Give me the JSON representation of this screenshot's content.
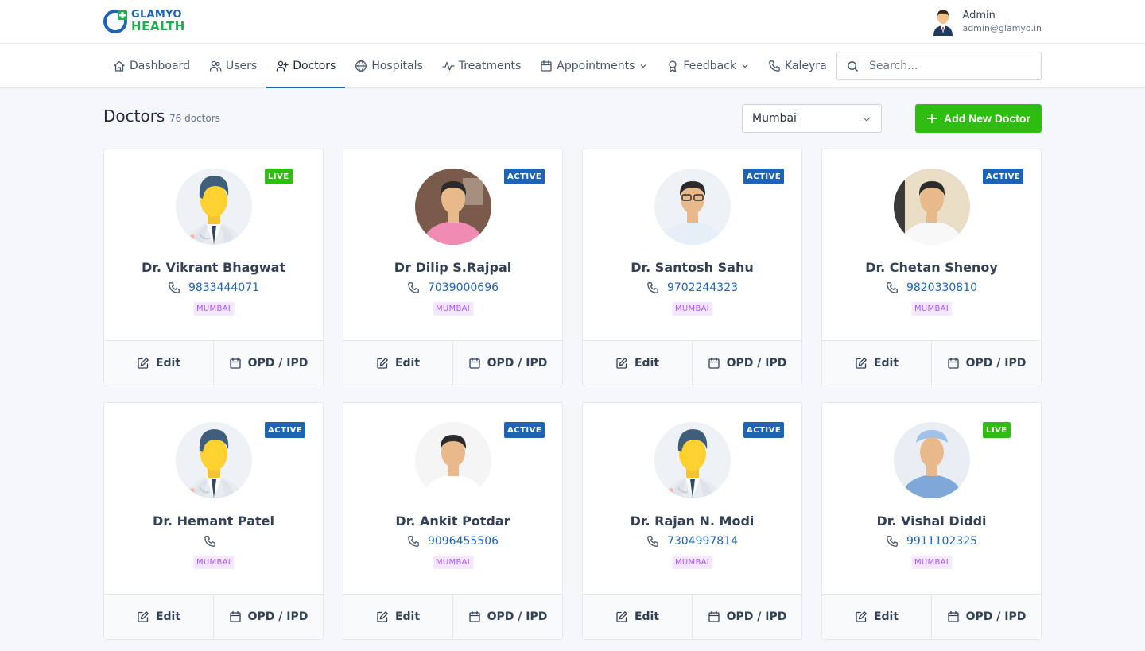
{
  "brand": {
    "line1": "GLAMYO",
    "line2": "HEALTH"
  },
  "user": {
    "name": "Admin",
    "email": "admin@glamyo.in"
  },
  "nav": [
    {
      "label": "Dashboard",
      "icon": "home-icon",
      "active": false,
      "dropdown": false
    },
    {
      "label": "Users",
      "icon": "users-icon",
      "active": false,
      "dropdown": false
    },
    {
      "label": "Doctors",
      "icon": "user-plus-icon",
      "active": true,
      "dropdown": false
    },
    {
      "label": "Hospitals",
      "icon": "globe-icon",
      "active": false,
      "dropdown": false
    },
    {
      "label": "Treatments",
      "icon": "activity-icon",
      "active": false,
      "dropdown": false
    },
    {
      "label": "Appointments",
      "icon": "calendar-icon",
      "active": false,
      "dropdown": true
    },
    {
      "label": "Feedback",
      "icon": "award-icon",
      "active": false,
      "dropdown": true
    },
    {
      "label": "Kaleyra",
      "icon": "phone-icon",
      "active": false,
      "dropdown": false
    }
  ],
  "search": {
    "placeholder": "Search..."
  },
  "page": {
    "title": "Doctors",
    "count": "76 doctors",
    "city_selected": "Mumbai",
    "add_button": "Add New Doctor"
  },
  "card_actions": {
    "edit": "Edit",
    "opd": "OPD / IPD"
  },
  "doctors": [
    {
      "name": "Dr. Vikrant Bhagwat",
      "phone": "9833444071",
      "city": "MUMBAI",
      "status": "LIVE",
      "photo": "placeholder"
    },
    {
      "name": "Dr Dilip S.Rajpal",
      "phone": "7039000696",
      "city": "MUMBAI",
      "status": "ACTIVE",
      "photo": "pink-shirt"
    },
    {
      "name": "Dr. Santosh Sahu",
      "phone": "9702244323",
      "city": "MUMBAI",
      "status": "ACTIVE",
      "photo": "glasses"
    },
    {
      "name": "Dr. Chetan Shenoy",
      "phone": "9820330810",
      "city": "MUMBAI",
      "status": "ACTIVE",
      "photo": "white-shirt"
    },
    {
      "name": "Dr. Hemant Patel",
      "phone": "",
      "city": "MUMBAI",
      "status": "ACTIVE",
      "photo": "placeholder"
    },
    {
      "name": "Dr. Ankit Potdar",
      "phone": "9096455506",
      "city": "MUMBAI",
      "status": "ACTIVE",
      "photo": "white-coat"
    },
    {
      "name": "Dr. Rajan N. Modi",
      "phone": "7304997814",
      "city": "MUMBAI",
      "status": "ACTIVE",
      "photo": "placeholder"
    },
    {
      "name": "Dr. Vishal Diddi",
      "phone": "9911102325",
      "city": "MUMBAI",
      "status": "LIVE",
      "photo": "scrubs"
    }
  ],
  "colors": {
    "brand_blue": "#1e64b4",
    "brand_green": "#2fbd11",
    "live_badge": "#2fbd11",
    "active_badge": "#1e64b4",
    "city_tag_bg": "#f3e8ff",
    "city_tag_text": "#a855f7"
  }
}
